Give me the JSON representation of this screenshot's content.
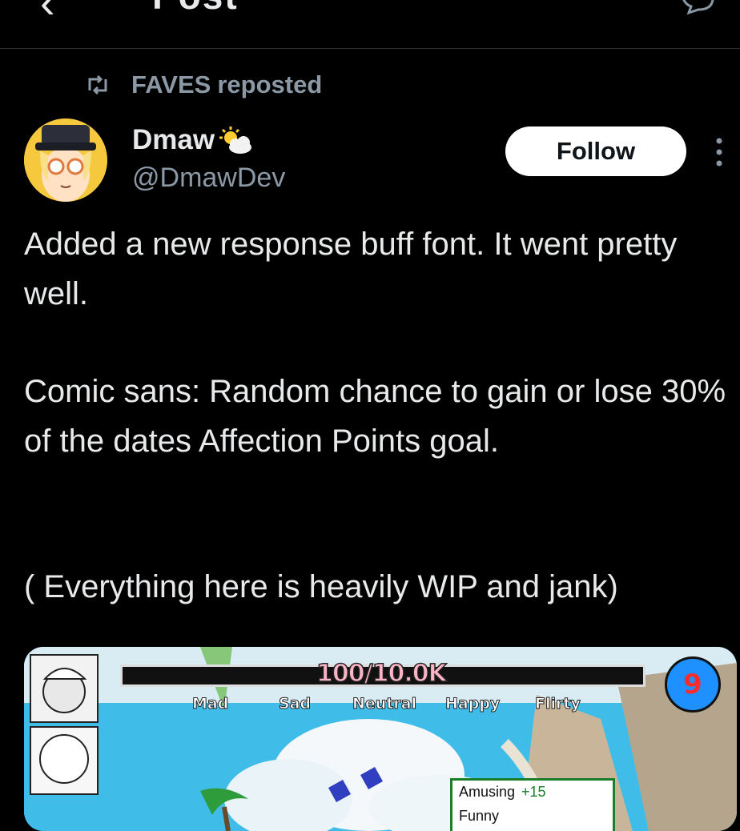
{
  "header": {
    "back_glyph": "‹",
    "title": "Post",
    "reply_icon": "reply-icon"
  },
  "repost": {
    "icon": "repost-icon",
    "who": "FAVES",
    "suffix": "reposted"
  },
  "author": {
    "name": "Dmaw",
    "badge_icon": "sun-behind-cloud-icon",
    "handle": "@DmawDev",
    "follow_label": "Follow",
    "more_icon": "more-vertical-icon"
  },
  "post": {
    "paragraph1": "Added a new response buff font. It went pretty well.",
    "paragraph2": "Comic sans: Random chance to gain or lose 30% of the dates Affection Points goal.",
    "paragraph3": "( Everything here is heavily WIP and jank)"
  },
  "media": {
    "affection_label": "100/10.0K",
    "moods": [
      "Mad",
      "Sad",
      "Neutral",
      "Happy",
      "Flirty"
    ],
    "counter": "9",
    "response": {
      "label": "Amusing",
      "bonus": "+15",
      "next": "Funny"
    }
  },
  "colors": {
    "accent_follow": "#ffffff",
    "muted": "#8b98a5",
    "game_sky": "#3fbde8"
  }
}
